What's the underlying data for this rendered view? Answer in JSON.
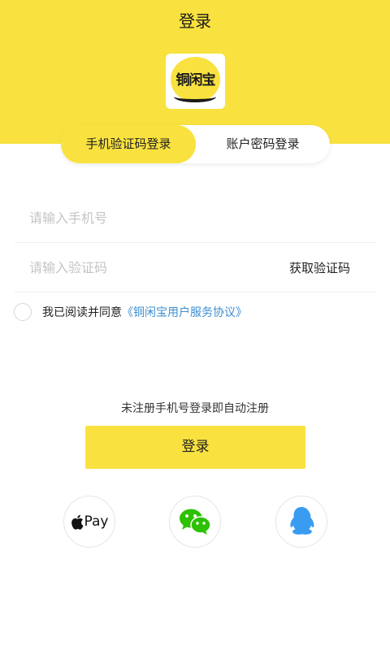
{
  "header": {
    "title": "登录"
  },
  "logo": {
    "text": "铜闲宝"
  },
  "tabs": [
    {
      "label": "手机验证码登录",
      "active": true
    },
    {
      "label": "账户密码登录",
      "active": false
    }
  ],
  "form": {
    "phone_placeholder": "请输入手机号",
    "code_placeholder": "请输入验证码",
    "get_code_label": "获取验证码"
  },
  "agreement": {
    "text": "我已阅读并同意",
    "link": "《铜闲宝用户服务协议》",
    "checked": false
  },
  "hint": "未注册手机号登录即自动注册",
  "login_button": "登录",
  "social": {
    "apple_pay_label": "Pay",
    "icons": [
      "apple-pay-icon",
      "wechat-icon",
      "qq-icon"
    ]
  },
  "colors": {
    "accent": "#f9e23f",
    "link": "#3c8ed3",
    "wechat": "#2dc100",
    "qq": "#3a9cf0"
  }
}
